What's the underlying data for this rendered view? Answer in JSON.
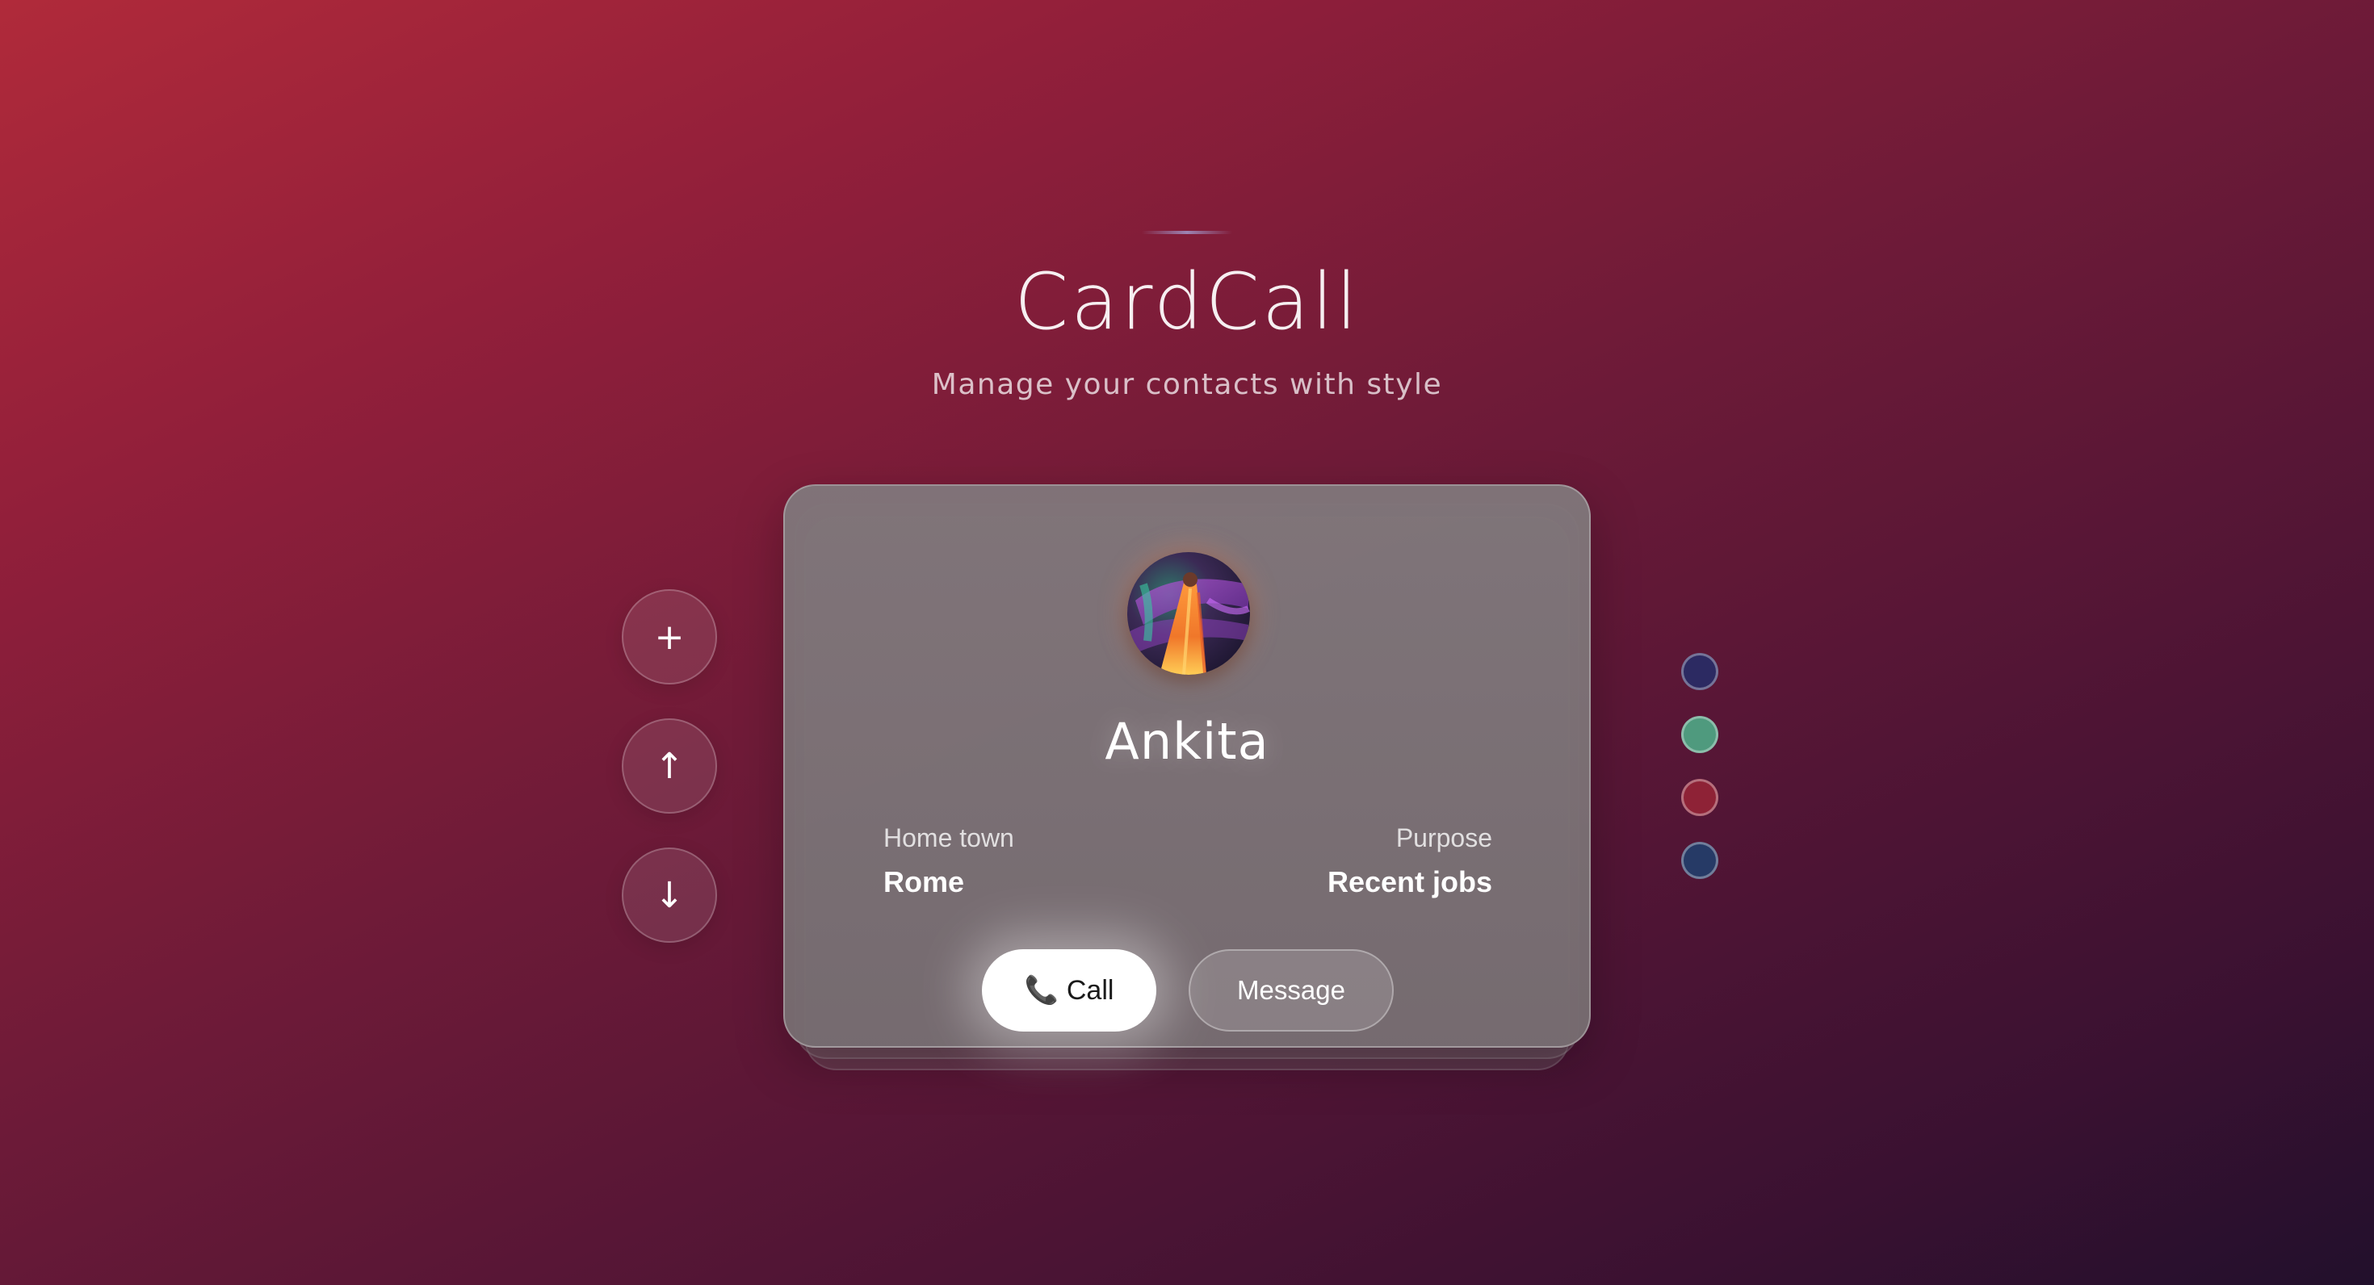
{
  "app": {
    "title": "CardCall",
    "subtitle": "Manage your contacts with style"
  },
  "controls": {
    "add_icon": "+",
    "up_icon": "↑",
    "down_icon": "↓"
  },
  "contact": {
    "name": "Ankita",
    "home_town_label": "Home town",
    "home_town": "Rome",
    "purpose_label": "Purpose",
    "purpose": "Recent jobs"
  },
  "actions": {
    "call_icon": "📞",
    "call_label": "Call",
    "message_label": "Message"
  },
  "themes": [
    {
      "name": "indigo",
      "color": "#2c2a62"
    },
    {
      "name": "green",
      "color": "#4f9a7e"
    },
    {
      "name": "crimson",
      "color": "#8e2236"
    },
    {
      "name": "navy",
      "color": "#263a66"
    }
  ]
}
